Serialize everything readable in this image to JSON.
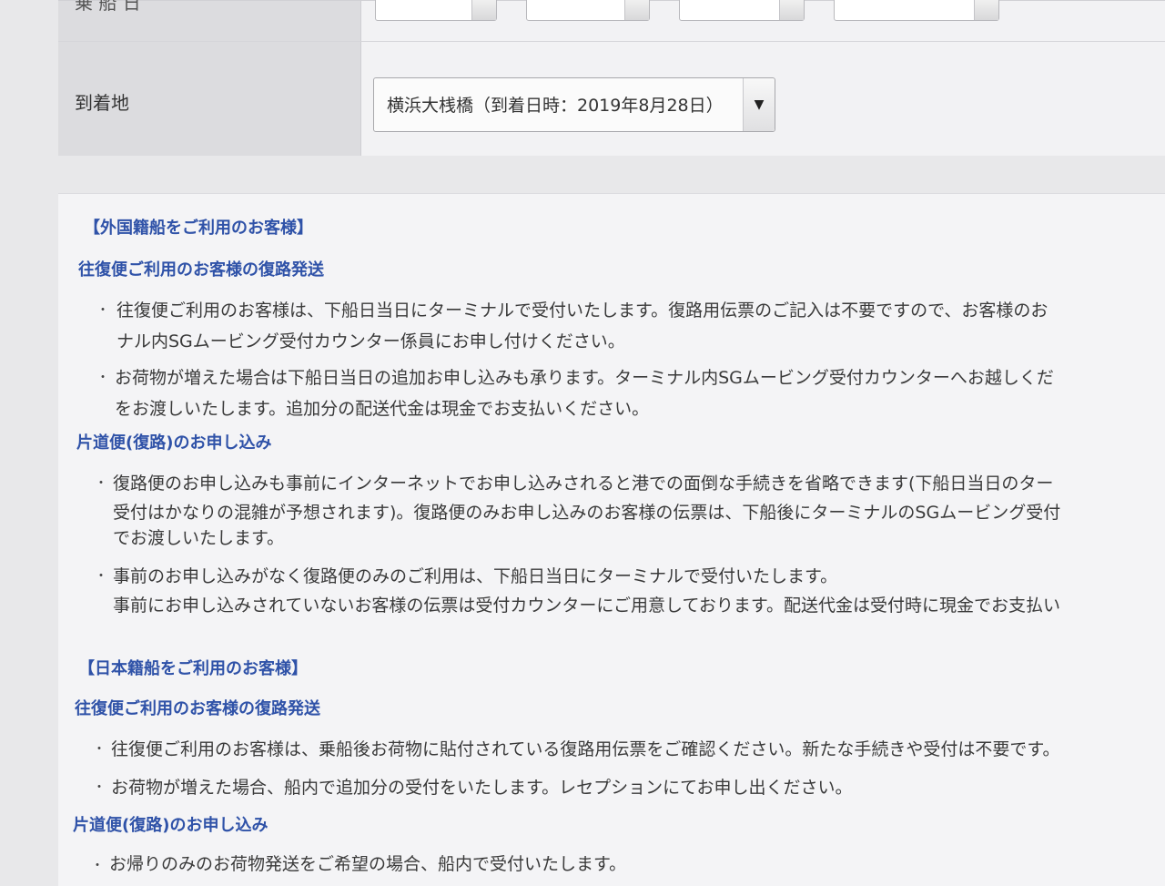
{
  "form": {
    "arrival_label": "到着地",
    "top_label_partial": "乗  船  日",
    "arrival_select_value": "横浜大桟橋（到着日時：2019年8月28日）",
    "arrival_select_arrow": "▼"
  },
  "foreign": {
    "heading": "【外国籍船をご利用のお客様】",
    "round_trip_heading": "往復便ご利用のお客様の復路発送",
    "round_trip_items": [
      [
        "往復便ご利用のお客様は、下船日当日にターミナルで受付いたします。復路用伝票のご記入は不要ですので、お客様のお",
        "ナル内SGムービング受付カウンター係員にお申し付けください。"
      ],
      [
        "お荷物が増えた場合は下船日当日の追加お申し込みも承ります。ターミナル内SGムービング受付カウンターへお越しくだ",
        "をお渡しいたします。追加分の配送代金は現金でお支払いください。"
      ]
    ],
    "one_way_heading": "片道便(復路)のお申し込み",
    "one_way_items": [
      [
        "復路便のお申し込みも事前にインターネットでお申し込みされると港での面倒な手続きを省略できます(下船日当日のター",
        "受付はかなりの混雑が予想されます)。復路便のみお申し込みのお客様の伝票は、下船後にターミナルのSGムービング受付",
        "でお渡しいたします。"
      ],
      [
        "事前のお申し込みがなく復路便のみのご利用は、下船日当日にターミナルで受付いたします。",
        "事前にお申し込みされていないお客様の伝票は受付カウンターにご用意しております。配送代金は受付時に現金でお支払い"
      ]
    ]
  },
  "japanese": {
    "heading": "【日本籍船をご利用のお客様】",
    "round_trip_heading": "往復便ご利用のお客様の復路発送",
    "round_trip_items": [
      [
        "往復便ご利用のお客様は、乗船後お荷物に貼付されている復路用伝票をご確認ください。新たな手続きや受付は不要です。"
      ],
      [
        "お荷物が増えた場合、船内で追加分の受付をいたします。レセプションにてお申し出ください。"
      ]
    ],
    "one_way_heading": "片道便(復路)のお申し込み",
    "one_way_items": [
      [
        "お帰りのみのお荷物発送をご希望の場合、船内で受付いたします。"
      ]
    ]
  },
  "bullet_char": "・"
}
